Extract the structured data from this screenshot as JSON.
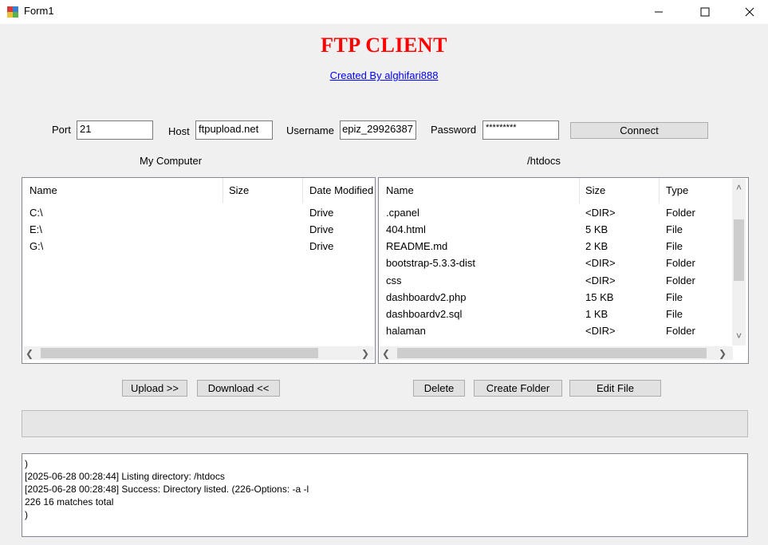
{
  "window": {
    "title": "Form1",
    "accent": "#ff0000",
    "link_color": "#0000ff"
  },
  "header": {
    "title": "FTP CLIENT",
    "credit": "Created By alghifari888"
  },
  "connection": {
    "port_label": "Port",
    "port_value": "21",
    "host_label": "Host",
    "host_value": "ftpupload.net",
    "username_label": "Username",
    "username_value": "epiz_29926387",
    "password_label": "Password",
    "password_value": "*********",
    "connect_label": "Connect"
  },
  "local": {
    "title": "My Computer",
    "columns": [
      "Name",
      "Size",
      "Date Modified"
    ],
    "rows": [
      {
        "name": "C:\\",
        "size": "",
        "date": "Drive"
      },
      {
        "name": "E:\\",
        "size": "",
        "date": "Drive"
      },
      {
        "name": "G:\\",
        "size": "",
        "date": "Drive"
      }
    ]
  },
  "remote": {
    "title": "/htdocs",
    "columns": [
      "Name",
      "Size",
      "Type"
    ],
    "rows": [
      {
        "name": ".cpanel",
        "size": "<DIR>",
        "type": "Folder"
      },
      {
        "name": "404.html",
        "size": "5 KB",
        "type": "File"
      },
      {
        "name": "README.md",
        "size": "2 KB",
        "type": "File"
      },
      {
        "name": "bootstrap-5.3.3-dist",
        "size": "<DIR>",
        "type": "Folder"
      },
      {
        "name": "css",
        "size": "<DIR>",
        "type": "Folder"
      },
      {
        "name": "dashboardv2.php",
        "size": "15 KB",
        "type": "File"
      },
      {
        "name": "dashboardv2.sql",
        "size": "1 KB",
        "type": "File"
      },
      {
        "name": "halaman",
        "size": "<DIR>",
        "type": "Folder"
      }
    ]
  },
  "actions": {
    "upload": "Upload >>",
    "download": "Download <<",
    "delete": "Delete",
    "create_folder": "Create Folder",
    "edit_file": "Edit File"
  },
  "progress": {
    "value": 0
  },
  "log": {
    "lines": [
      ")",
      "[2025-06-28 00:28:44] Listing directory: /htdocs",
      "[2025-06-28 00:28:48] Success: Directory listed. (226-Options: -a -l",
      "226 16 matches total",
      ")"
    ]
  }
}
